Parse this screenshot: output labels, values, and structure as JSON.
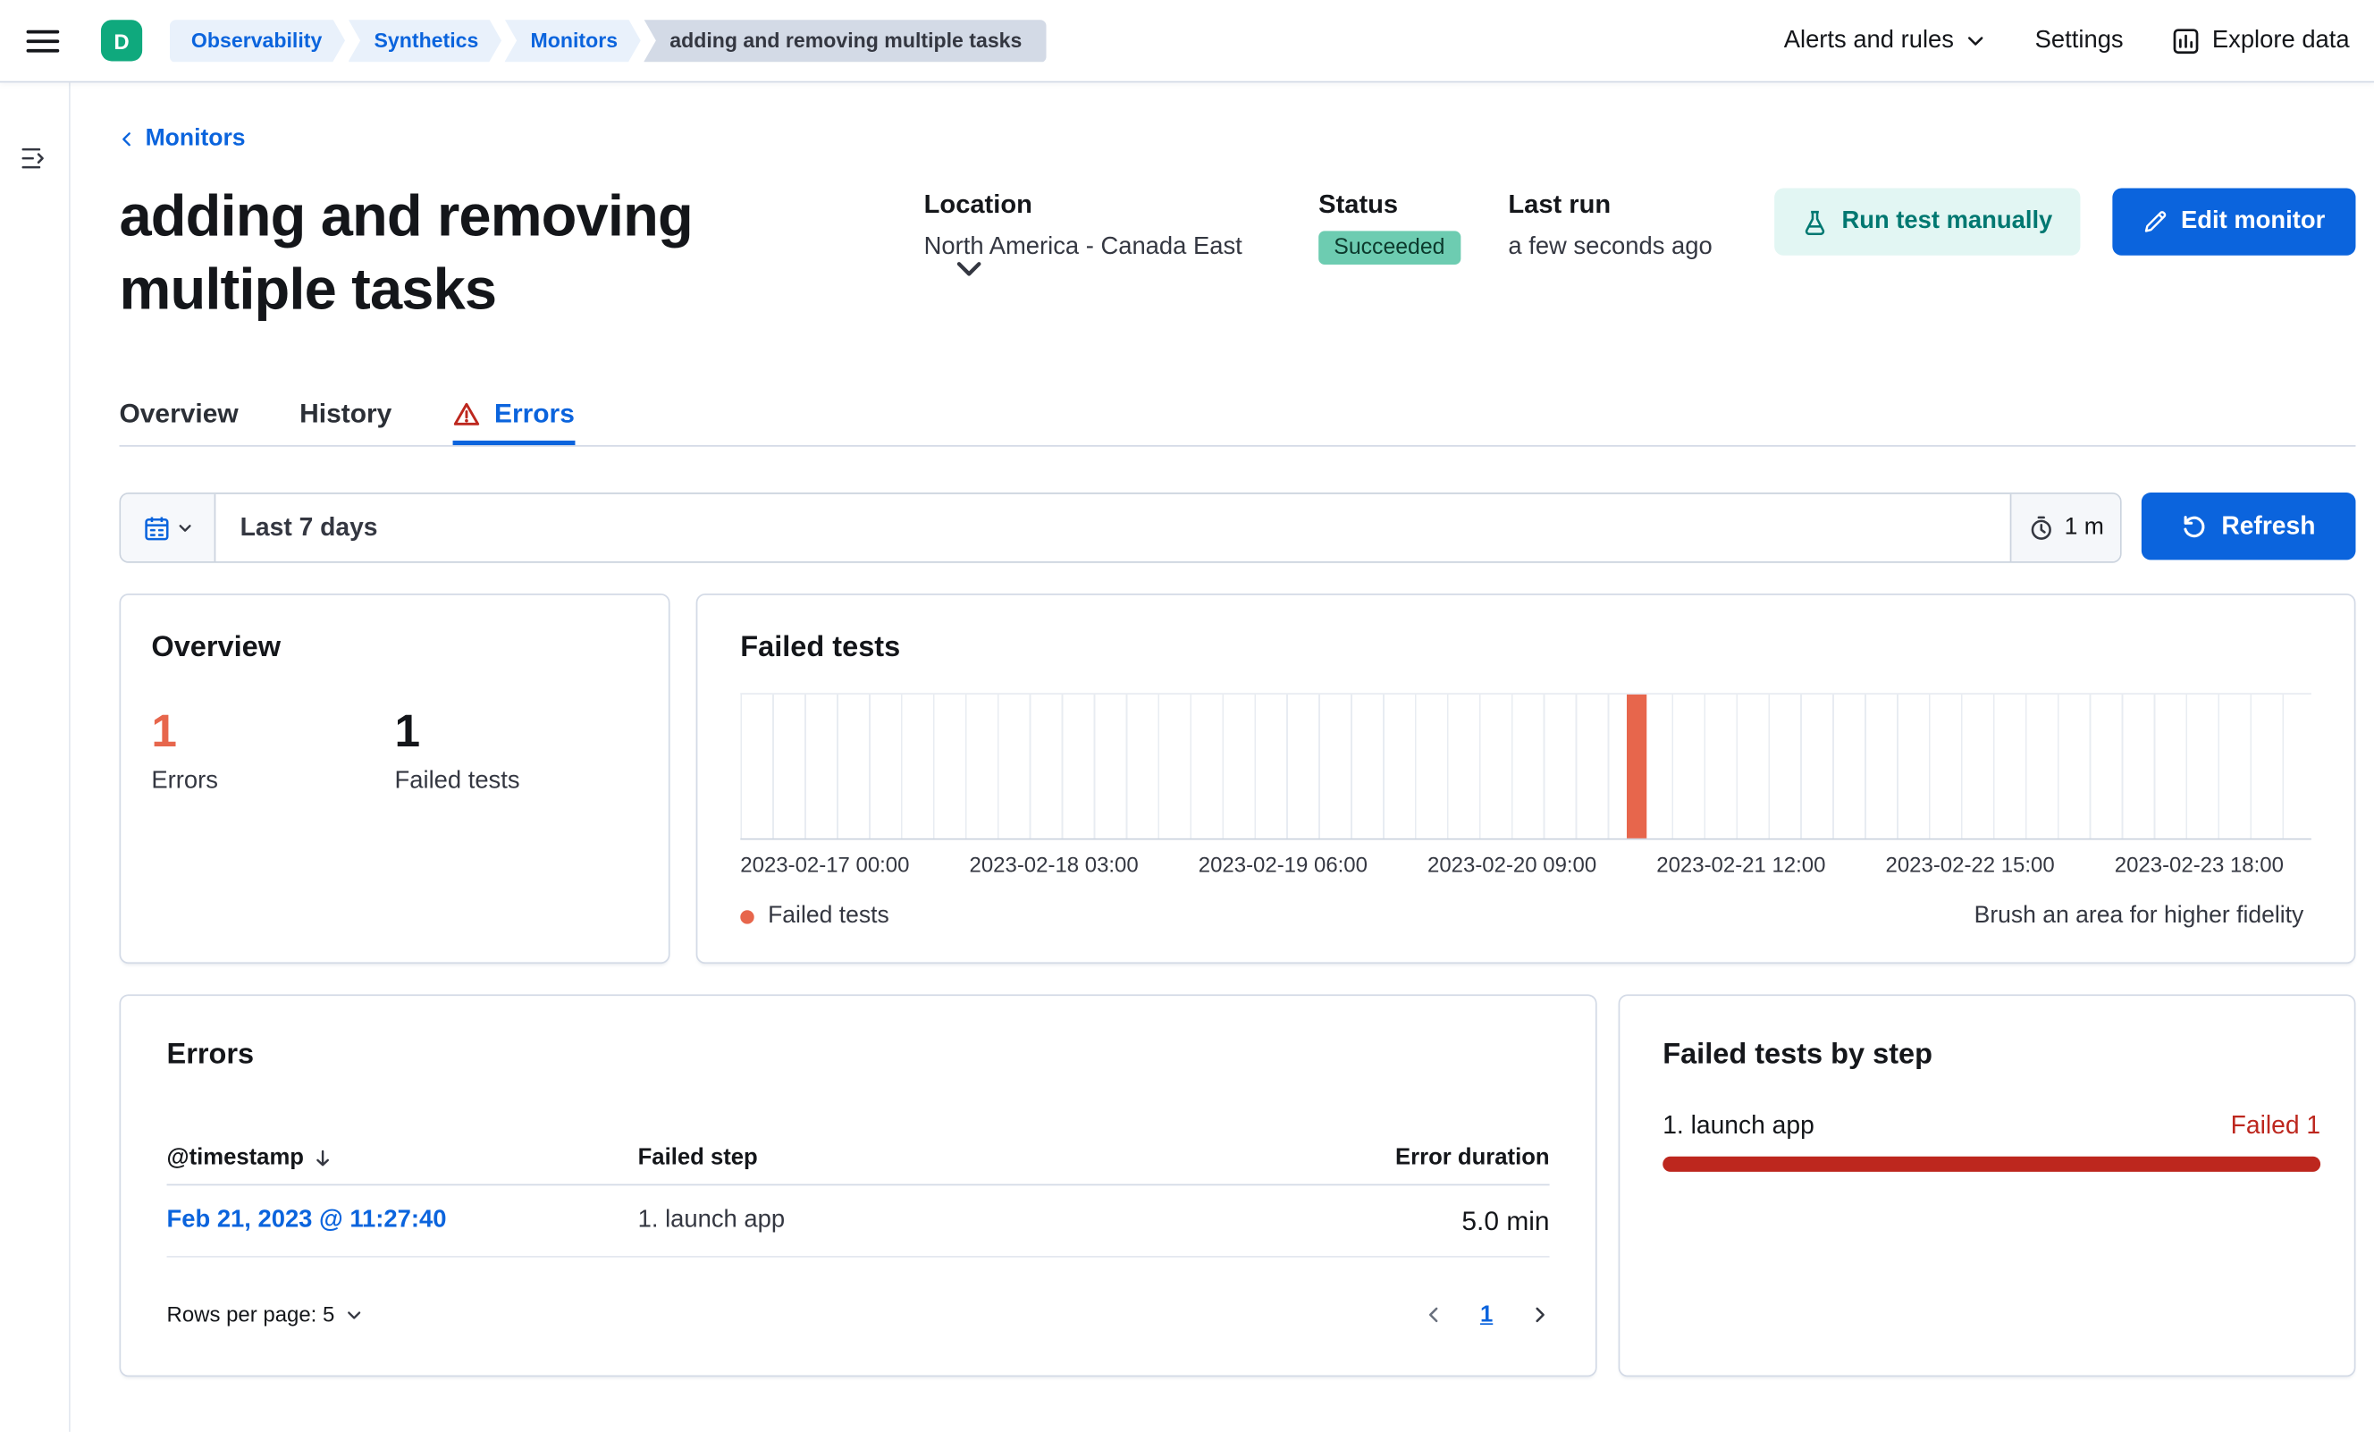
{
  "colors": {
    "primary": "#0b64dd",
    "danger": "#bd271e",
    "visred": "#e7664c",
    "successbg": "#6dccb1",
    "tealtext": "#007871",
    "tealbg": "#e2f6f3",
    "avatarbg": "#0fa97d"
  },
  "header": {
    "avatar_initial": "D",
    "breadcrumbs": [
      "Observability",
      "Synthetics",
      "Monitors",
      "adding and removing multiple tasks"
    ],
    "alerts_menu": "Alerts and rules",
    "settings": "Settings",
    "explore_data": "Explore data"
  },
  "page": {
    "back_link": "Monitors",
    "title": "adding and removing multiple tasks",
    "location_label": "Location",
    "location_value": "North America - Canada East",
    "status_label": "Status",
    "status_value": "Succeeded",
    "last_run_label": "Last run",
    "last_run_value": "a few seconds ago",
    "run_test_button": "Run test manually",
    "edit_button": "Edit monitor"
  },
  "tabs": [
    {
      "label": "Overview",
      "active": false
    },
    {
      "label": "History",
      "active": false
    },
    {
      "label": "Errors",
      "active": true
    }
  ],
  "filter": {
    "time_range": "Last 7 days",
    "interval": "1 m",
    "refresh_button": "Refresh"
  },
  "overview_card": {
    "title": "Overview",
    "errors_value": "1",
    "errors_label": "Errors",
    "failed_value": "1",
    "failed_label": "Failed tests"
  },
  "failed_tests_card": {
    "title": "Failed tests",
    "legend_label": "Failed tests",
    "hint": "Brush an area for higher fidelity",
    "chart_data": {
      "type": "bar",
      "x_ticks": [
        "2023-02-17 00:00",
        "2023-02-18 03:00",
        "2023-02-19 06:00",
        "2023-02-20 09:00",
        "2023-02-21 12:00",
        "2023-02-22 15:00",
        "2023-02-23 18:00"
      ],
      "series": [
        {
          "name": "Failed tests",
          "points": [
            {
              "x": "2023-02-21 11:27",
              "y": 1
            }
          ]
        }
      ],
      "ylim": [
        0,
        1
      ],
      "bar_color": "#e7664c",
      "bar_position_pct": 57.1
    }
  },
  "errors_card": {
    "title": "Errors",
    "col_timestamp": "@timestamp",
    "col_failed_step": "Failed step",
    "col_error_duration": "Error duration",
    "rows": [
      {
        "timestamp": "Feb 21, 2023 @ 11:27:40",
        "failed_step": "1. launch app",
        "error_duration": "5.0 min"
      }
    ],
    "rows_per_page": "Rows per page: 5",
    "page_number": "1"
  },
  "failed_by_step_card": {
    "title": "Failed tests by step",
    "steps": [
      {
        "label": "1. launch app",
        "result": "Failed 1",
        "pct": 100
      }
    ]
  }
}
